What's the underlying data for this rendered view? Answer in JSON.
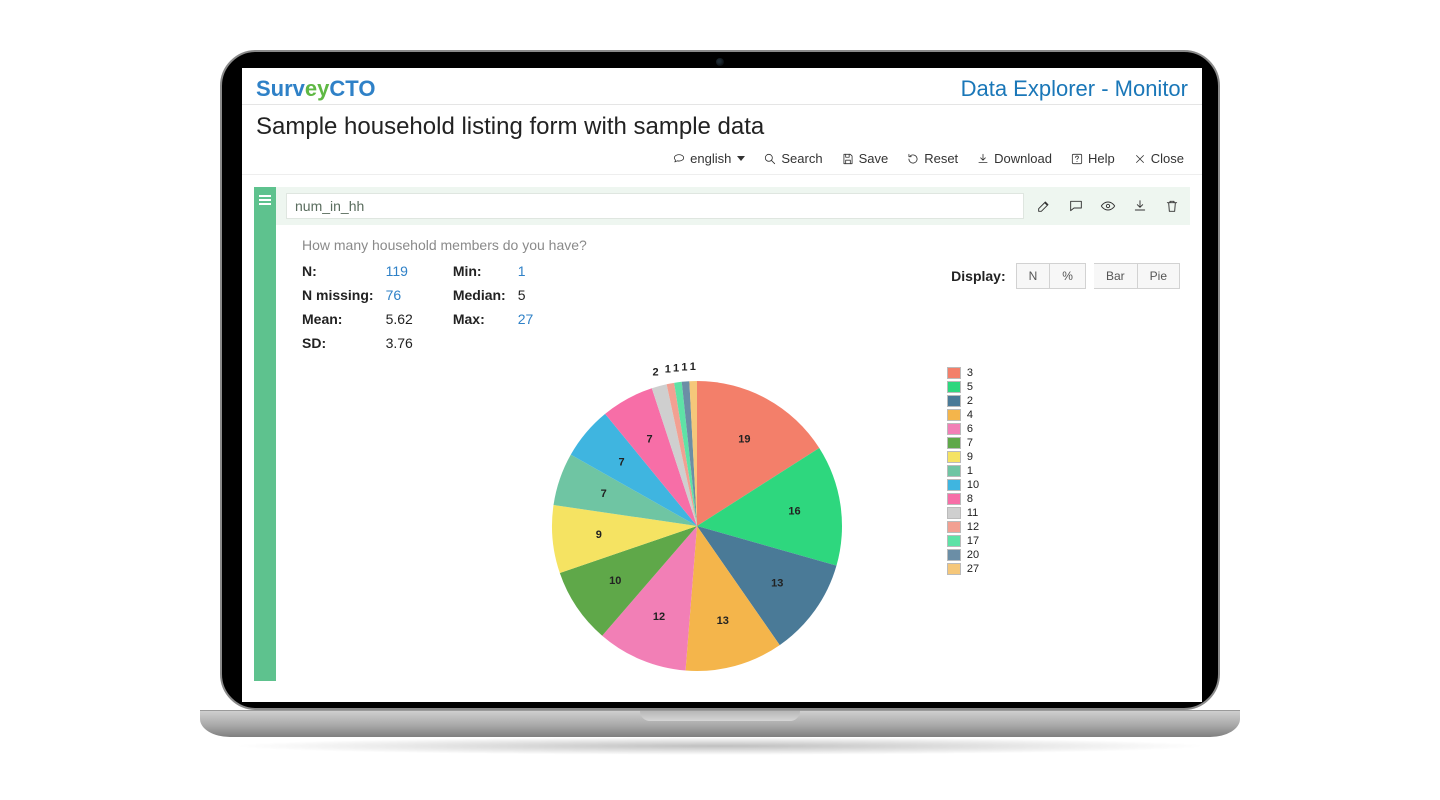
{
  "brand": {
    "part1": "Surv",
    "part2": "ey",
    "part3": "CTO"
  },
  "app_title": "Data Explorer - Monitor",
  "page_title": "Sample household listing form with sample data",
  "toolbar": {
    "language": "english",
    "search": "Search",
    "save": "Save",
    "reset": "Reset",
    "download": "Download",
    "help": "Help",
    "close": "Close"
  },
  "variable": {
    "name": "num_in_hh",
    "label": "How many household members do you have?"
  },
  "stats": {
    "n_label": "N:",
    "n_value": "119",
    "nmiss_label": "N missing:",
    "nmiss_value": "76",
    "mean_label": "Mean:",
    "mean_value": "5.62",
    "sd_label": "SD:",
    "sd_value": "3.76",
    "min_label": "Min:",
    "min_value": "1",
    "median_label": "Median:",
    "median_value": "5",
    "max_label": "Max:",
    "max_value": "27"
  },
  "display": {
    "label": "Display:",
    "options": {
      "n": "N",
      "pct": "%",
      "bar": "Bar",
      "pie": "Pie"
    },
    "active": "pie"
  },
  "chart_data": {
    "type": "pie",
    "title": "",
    "slices": [
      {
        "key": "3",
        "value": 19,
        "color": "#f37f6a"
      },
      {
        "key": "5",
        "value": 16,
        "color": "#2ed77e"
      },
      {
        "key": "2",
        "value": 13,
        "color": "#4a7a97"
      },
      {
        "key": "4",
        "value": 13,
        "color": "#f4b54b"
      },
      {
        "key": "6",
        "value": 12,
        "color": "#f27fb6"
      },
      {
        "key": "7",
        "value": 10,
        "color": "#5fa849"
      },
      {
        "key": "9",
        "value": 9,
        "color": "#f5e362"
      },
      {
        "key": "1",
        "value": 7,
        "color": "#6fc5a3"
      },
      {
        "key": "10",
        "value": 7,
        "color": "#3fb5e0"
      },
      {
        "key": "8",
        "value": 7,
        "color": "#f76ea7"
      },
      {
        "key": "11",
        "value": 2,
        "color": "#cfcfcf"
      },
      {
        "key": "12",
        "value": 1,
        "color": "#f2a092"
      },
      {
        "key": "17",
        "value": 1,
        "color": "#5ee2a6"
      },
      {
        "key": "20",
        "value": 1,
        "color": "#6b8ea6"
      },
      {
        "key": "27",
        "value": 1,
        "color": "#f5c77a"
      }
    ],
    "legend_order": [
      "3",
      "5",
      "2",
      "4",
      "6",
      "7",
      "9",
      "1",
      "10",
      "8",
      "11",
      "12",
      "17",
      "20",
      "27"
    ]
  }
}
